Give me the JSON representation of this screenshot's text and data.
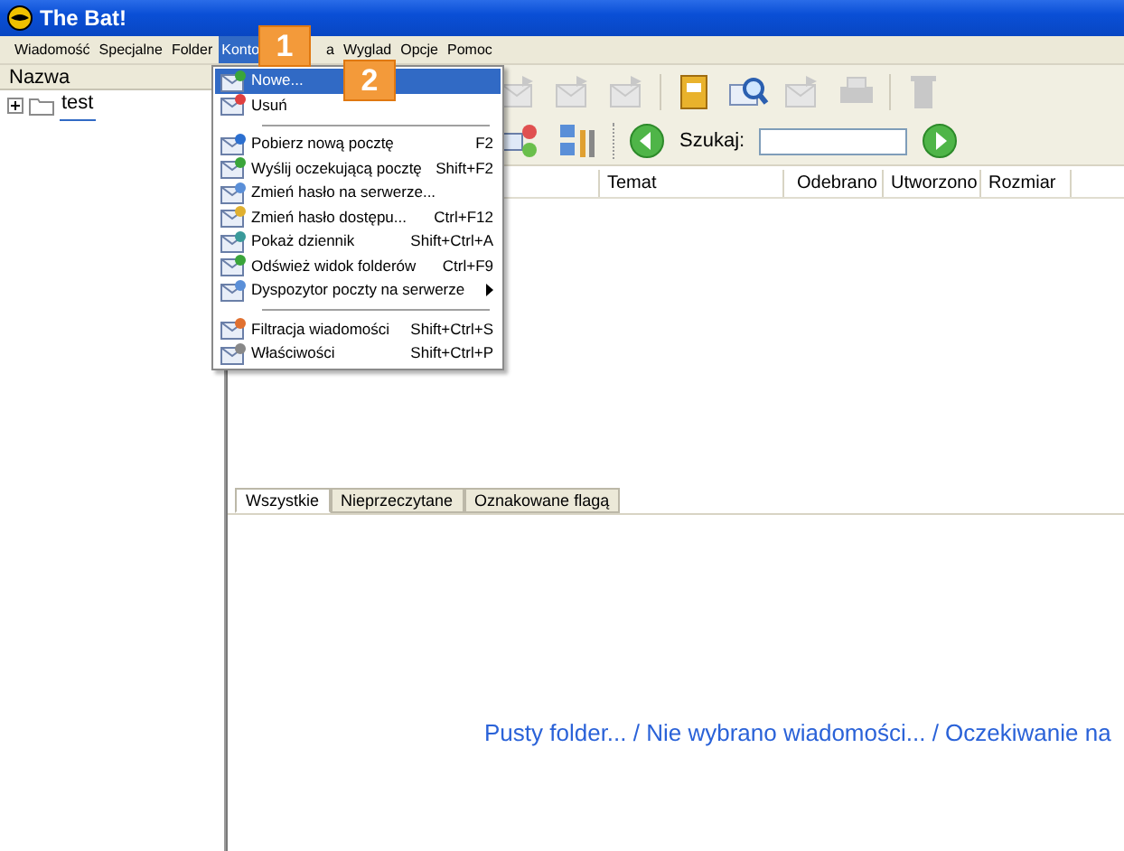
{
  "window": {
    "title": "The Bat!"
  },
  "menu_bar": [
    {
      "label": "Wiadomość",
      "selected": false
    },
    {
      "label": "Specjalne",
      "selected": false
    },
    {
      "label": "Folder",
      "selected": false
    },
    {
      "label": "Konto",
      "selected": true
    },
    {
      "label": "a",
      "selected": false
    },
    {
      "label": "Wyglad",
      "selected": false
    },
    {
      "label": "Opcje",
      "selected": false
    },
    {
      "label": "Pomoc",
      "selected": false
    }
  ],
  "callouts": [
    "1",
    "2"
  ],
  "folder_panel": {
    "header": "Nazwa",
    "folders": [
      {
        "label": "test",
        "expanded": false
      }
    ]
  },
  "dropdown": [
    {
      "kind": "item",
      "label": "Nowe...",
      "selected": true
    },
    {
      "kind": "item",
      "label": "Usuń",
      "selected": false
    },
    {
      "kind": "separator"
    },
    {
      "kind": "item",
      "label": "Pobierz nową pocztę",
      "shortcut": "F2",
      "selected": false
    },
    {
      "kind": "item",
      "label": "Wyślij oczekującą pocztę",
      "shortcut": "Shift+F2",
      "selected": false
    },
    {
      "kind": "item",
      "label": "Zmień hasło na serwerze...",
      "selected": false
    },
    {
      "kind": "item",
      "label": "Zmień hasło dostępu...",
      "shortcut": "Ctrl+F12",
      "selected": false
    },
    {
      "kind": "item",
      "label": "Pokaż dziennik",
      "shortcut": "Shift+Ctrl+A",
      "selected": false
    },
    {
      "kind": "item",
      "label": "Odśwież widok folderów",
      "shortcut": "Ctrl+F9",
      "selected": false
    },
    {
      "kind": "submenu",
      "label": "Dyspozytor poczty na serwerze",
      "selected": false
    },
    {
      "kind": "separator"
    },
    {
      "kind": "item",
      "label": "Filtracja wiadomości",
      "shortcut": "Shift+Ctrl+S",
      "selected": false
    },
    {
      "kind": "item",
      "label": "Właściwości",
      "shortcut": "Shift+Ctrl+P",
      "selected": false
    }
  ],
  "search": {
    "label": "Szukaj:"
  },
  "columns": [
    "Temat",
    "Odebrano",
    "Utworzono",
    "Rozmiar"
  ],
  "tabs": [
    {
      "label": "Wszystkie",
      "selected": true
    },
    {
      "label": "Nieprzeczytane",
      "selected": false
    },
    {
      "label": "Oznakowane flagą",
      "selected": false
    }
  ],
  "preview_message": "Pusty folder... / Nie wybrano wiadomości... / Oczekiwanie na"
}
